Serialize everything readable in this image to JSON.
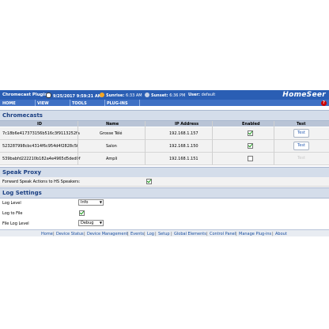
{
  "header": {
    "title": "Chromecast Plugin",
    "datetime": "9/25/2017 9:59:21 AM",
    "sunrise_label": "Sunrise:",
    "sunrise_time": "6:33 AM",
    "sunset_label": "Sunset:",
    "sunset_time": "6:36 PM",
    "user_label": "User:",
    "user_value": "default",
    "logo": "HomeSeer"
  },
  "nav": {
    "items": [
      "HOME",
      "VIEW",
      "TOOLS",
      "PLUG-INS"
    ],
    "help": "?"
  },
  "chromecasts": {
    "section_title": "Chromecasts",
    "columns": [
      "ID",
      "Name",
      "IP Address",
      "Enabled",
      "Test"
    ],
    "rows": [
      {
        "id": "7c18b6e417373156b516c3f9113252fa",
        "name": "Grosse Télé",
        "ip": "192.168.1.157",
        "enabled": true,
        "test": "Test",
        "test_enabled": true
      },
      {
        "id": "523287998cbc4314f6c954d4f2828c5f",
        "name": "Salon",
        "ip": "192.168.1.150",
        "enabled": true,
        "test": "Test",
        "test_enabled": true
      },
      {
        "id": "539babfd222210b182a4e4965d5ded0f",
        "name": "Ampli",
        "ip": "192.168.1.151",
        "enabled": false,
        "test": "Test",
        "test_enabled": false
      }
    ]
  },
  "speak_proxy": {
    "section_title": "Speak Proxy",
    "forward_label": "Forward Speak Actions to HS Speakers:",
    "forward_checked": true
  },
  "log_settings": {
    "section_title": "Log Settings",
    "log_level_label": "Log Level",
    "log_level_value": "Info",
    "log_to_file_label": "Log to File",
    "log_to_file_checked": true,
    "file_log_level_label": "File Log Level",
    "file_log_level_value": "Debug"
  },
  "footer": {
    "links": [
      "Home",
      "Device Status",
      "Device Management",
      "Events",
      "Log",
      "Setup",
      "Global Elements",
      "Control Panel",
      "Manage Plug-ins",
      "About"
    ],
    "separator": "|"
  },
  "colors": {
    "header_bg": "#2a5eb4",
    "nav_bg": "#3e70c4",
    "section_bg": "#d4ddea",
    "check_green": "#1a9a1a",
    "help_red": "#cc0000"
  }
}
